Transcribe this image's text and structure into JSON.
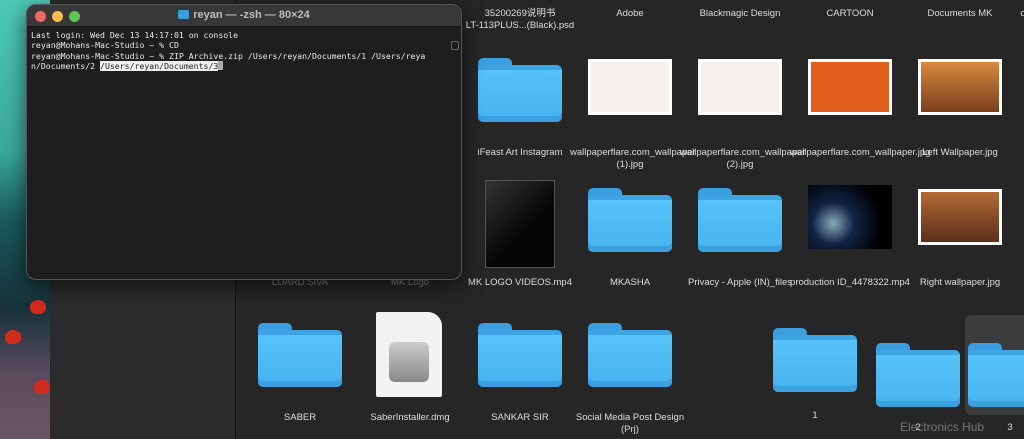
{
  "terminal": {
    "title": "reyan — -zsh — 80×24",
    "lines": [
      "Last login: Wed Dec 13 14:17:01 on console",
      "reyan@Mohans-Mac-Studio ~ % CD",
      "reyan@Mohans-Mac-Studio ~ % ZIP Archive.zip /Users/reyan/Documents/1 /Users/reya",
      "n/Documents/2 "
    ],
    "selected_text": "/Users/reyan/Documents/3"
  },
  "top_labels": [
    "35200269说明书\nLT-113PLUS...(Black).psd",
    "Adobe",
    "Blackmagic Design",
    "CARTOON",
    "Documents MK",
    "d"
  ],
  "items": [
    {
      "label": "iFeast Art Instagram",
      "kind": "folder"
    },
    {
      "label": "wallpaperflare.com_wallpaper (1).jpg",
      "kind": "image"
    },
    {
      "label": "wallpaperflare.com_wallpaper (2).jpg",
      "kind": "image"
    },
    {
      "label": "wallpaperflare.com_wallpaper.jpg",
      "kind": "image"
    },
    {
      "label": "Left Wallpaper.jpg",
      "kind": "image"
    },
    {
      "label": "LOARD SIVA",
      "kind": "hidden"
    },
    {
      "label": "MK Logo",
      "kind": "hidden"
    },
    {
      "label": "MK LOGO VIDEOS.mp4",
      "kind": "video"
    },
    {
      "label": "MKASHA",
      "kind": "folder"
    },
    {
      "label": "Privacy - Apple (IN)_files",
      "kind": "folder"
    },
    {
      "label": "production ID_4478322.mp4",
      "kind": "video"
    },
    {
      "label": "Right wallpaper.jpg",
      "kind": "image"
    },
    {
      "label": "SABER",
      "kind": "folder"
    },
    {
      "label": "SaberInstaller.dmg",
      "kind": "dmg"
    },
    {
      "label": "SANKAR SIR",
      "kind": "folder"
    },
    {
      "label": "Social Media Post Design (Prj)",
      "kind": "folder"
    },
    {
      "label": "1",
      "kind": "folder"
    },
    {
      "label": "2",
      "kind": "folder"
    },
    {
      "label": "3",
      "kind": "folder"
    }
  ],
  "watermark": "Electronics Hub"
}
